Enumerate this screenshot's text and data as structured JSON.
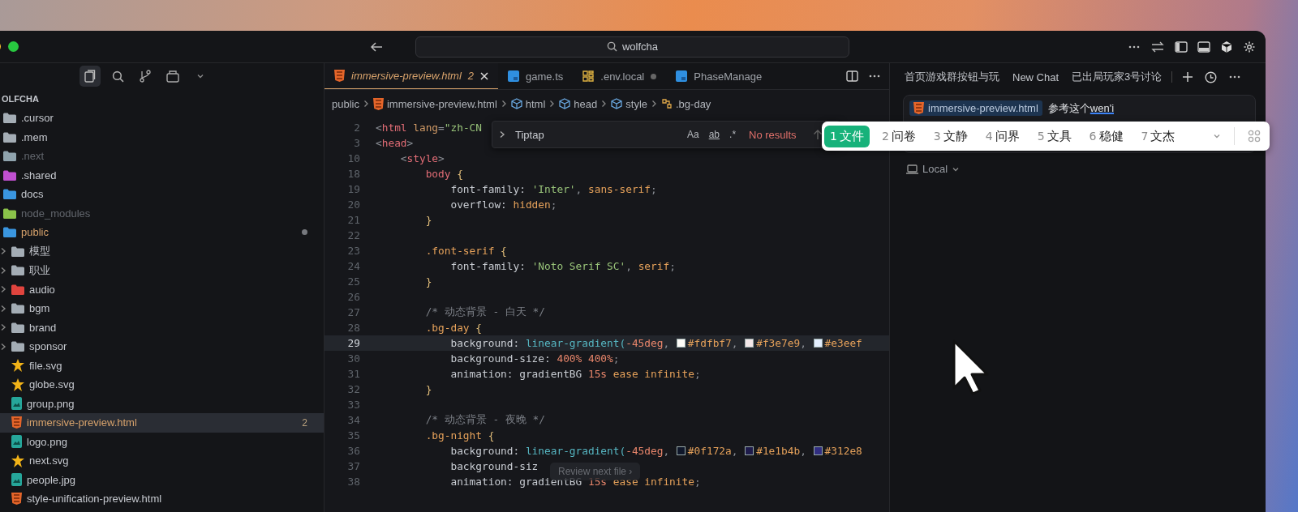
{
  "title_bar": {
    "search": "wolfcha"
  },
  "sidebar": {
    "root": "OLFCHA",
    "items": [
      {
        "name": ".cursor",
        "kind": "folder",
        "color": "#a4adb5",
        "selected": false,
        "dimmed": false,
        "modified": false
      },
      {
        "name": ".mem",
        "kind": "folder",
        "color": "#a4adb5",
        "selected": false,
        "dimmed": false,
        "modified": false
      },
      {
        "name": ".next",
        "kind": "folder",
        "color": "#8fa3ad",
        "selected": false,
        "dimmed": true,
        "modified": false
      },
      {
        "name": ".shared",
        "kind": "folder",
        "color": "#c050d0",
        "selected": false,
        "dimmed": false,
        "modified": false
      },
      {
        "name": "docs",
        "kind": "folder",
        "color": "#3a96e0",
        "selected": false,
        "dimmed": false,
        "modified": false
      },
      {
        "name": "node_modules",
        "kind": "folder",
        "color": "#8bc34a",
        "selected": false,
        "dimmed": true,
        "modified": false
      },
      {
        "name": "public",
        "kind": "folder",
        "color": "#3a96e0",
        "selected": false,
        "dimmed": false,
        "modified": true,
        "dot": true,
        "children": [
          {
            "name": "模型",
            "kind": "folder",
            "color": "#a4adb5",
            "expanded": false,
            "selected": false,
            "dimmed": false,
            "modified": false
          },
          {
            "name": "职业",
            "kind": "folder",
            "color": "#a4adb5",
            "expanded": false,
            "selected": false,
            "dimmed": false,
            "modified": false
          },
          {
            "name": "audio",
            "kind": "folder",
            "color": "#e0443e",
            "expanded": false,
            "selected": false,
            "dimmed": false,
            "modified": false
          },
          {
            "name": "bgm",
            "kind": "folder",
            "color": "#a4adb5",
            "expanded": false,
            "selected": false,
            "dimmed": false,
            "modified": false
          },
          {
            "name": "brand",
            "kind": "folder",
            "color": "#a4adb5",
            "expanded": false,
            "selected": false,
            "dimmed": false,
            "modified": false
          },
          {
            "name": "sponsor",
            "kind": "folder",
            "color": "#a4adb5",
            "expanded": false,
            "selected": false,
            "dimmed": false,
            "modified": false
          },
          {
            "name": "file.svg",
            "kind": "svg",
            "selected": false,
            "dimmed": false,
            "modified": false
          },
          {
            "name": "globe.svg",
            "kind": "svg",
            "selected": false,
            "dimmed": false,
            "modified": false
          },
          {
            "name": "group.png",
            "kind": "image",
            "selected": false,
            "dimmed": false,
            "modified": false
          },
          {
            "name": "immersive-preview.html",
            "kind": "html",
            "selected": true,
            "dimmed": false,
            "modified": true,
            "badge": "2"
          },
          {
            "name": "logo.png",
            "kind": "image",
            "selected": false,
            "dimmed": false,
            "modified": false
          },
          {
            "name": "next.svg",
            "kind": "svg",
            "selected": false,
            "dimmed": false,
            "modified": false
          },
          {
            "name": "people.jpg",
            "kind": "image",
            "selected": false,
            "dimmed": false,
            "modified": false
          },
          {
            "name": "style-unification-preview.html",
            "kind": "html",
            "selected": false,
            "dimmed": false,
            "modified": false
          }
        ]
      }
    ]
  },
  "editor": {
    "tabs": [
      {
        "label": "immersive-preview.html",
        "kind": "html",
        "badge": "2",
        "selected": true,
        "dot": false
      },
      {
        "label": "game.ts",
        "kind": "ts",
        "selected": false,
        "dot": false
      },
      {
        "label": ".env.local",
        "kind": "env",
        "selected": false,
        "dot": true
      },
      {
        "label": "PhaseManage",
        "kind": "ts",
        "selected": false,
        "dot": false
      }
    ],
    "breadcrumb": [
      {
        "label": "public",
        "kind": "folder"
      },
      {
        "label": "immersive-preview.html",
        "kind": "html"
      },
      {
        "label": "html",
        "kind": "element"
      },
      {
        "label": "head",
        "kind": "element"
      },
      {
        "label": "style",
        "kind": "element"
      },
      {
        "label": ".bg-day",
        "kind": "selector"
      }
    ],
    "find": {
      "value": "Tiptap",
      "options": [
        "Aa",
        "ab",
        ".*"
      ],
      "result": "No results"
    },
    "lines": [
      {
        "number": "2",
        "current": false,
        "tokens": [
          {
            "kind": "punct",
            "text": "<"
          },
          {
            "kind": "tag",
            "text": "html"
          },
          {
            "kind": "attr",
            "text": " lang"
          },
          {
            "kind": "punct",
            "text": "="
          },
          {
            "kind": "str",
            "text": "\"zh-CN"
          }
        ]
      },
      {
        "number": "3",
        "current": false,
        "tokens": [
          {
            "kind": "punct",
            "text": "<"
          },
          {
            "kind": "tag",
            "text": "head"
          },
          {
            "kind": "punct",
            "text": ">"
          }
        ]
      },
      {
        "number": "10",
        "current": false,
        "tokens": [
          {
            "kind": "punct",
            "text": "    <"
          },
          {
            "kind": "tag",
            "text": "style"
          },
          {
            "kind": "punct",
            "text": ">"
          }
        ]
      },
      {
        "number": "18",
        "current": false,
        "tokens": [
          {
            "kind": "tag",
            "text": "        body"
          },
          {
            "kind": "brace",
            "text": " {"
          }
        ]
      },
      {
        "number": "19",
        "current": false,
        "tokens": [
          {
            "kind": "prop",
            "text": "            font-family: "
          },
          {
            "kind": "str",
            "text": "'Inter'"
          },
          {
            "kind": "punct",
            "text": ", "
          },
          {
            "kind": "val",
            "text": "sans-serif"
          },
          {
            "kind": "punct",
            "text": ";"
          }
        ]
      },
      {
        "number": "20",
        "current": false,
        "tokens": [
          {
            "kind": "prop",
            "text": "            overflow: "
          },
          {
            "kind": "val",
            "text": "hidden"
          },
          {
            "kind": "punct",
            "text": ";"
          }
        ]
      },
      {
        "number": "21",
        "current": false,
        "tokens": [
          {
            "kind": "brace",
            "text": "        }"
          }
        ]
      },
      {
        "number": "22",
        "current": false
      },
      {
        "number": "23",
        "current": false,
        "tokens": [
          {
            "kind": "sel",
            "text": "        .font-serif"
          },
          {
            "kind": "brace",
            "text": " {"
          }
        ]
      },
      {
        "number": "24",
        "current": false,
        "tokens": [
          {
            "kind": "prop",
            "text": "            font-family: "
          },
          {
            "kind": "str",
            "text": "'Noto Serif SC'"
          },
          {
            "kind": "punct",
            "text": ", "
          },
          {
            "kind": "val",
            "text": "serif"
          },
          {
            "kind": "punct",
            "text": ";"
          }
        ]
      },
      {
        "number": "25",
        "current": false,
        "tokens": [
          {
            "kind": "brace",
            "text": "        }"
          }
        ]
      },
      {
        "number": "26",
        "current": false
      },
      {
        "number": "27",
        "current": false,
        "tokens": [
          {
            "kind": "comment",
            "text": "        /* 动态背景 - 白天 */"
          }
        ]
      },
      {
        "number": "28",
        "current": false,
        "tokens": [
          {
            "kind": "sel",
            "text": "        .bg-day"
          },
          {
            "kind": "brace",
            "text": " {"
          }
        ]
      },
      {
        "number": "29",
        "current": true,
        "tokens": [
          {
            "kind": "prop",
            "text": "            background: "
          },
          {
            "kind": "fn",
            "text": "linear-gradient("
          },
          {
            "kind": "num",
            "text": "-45deg"
          },
          {
            "kind": "punct",
            "text": ", "
          },
          {
            "kind": "color",
            "text": "#fdfbf7",
            "color": "#fdfbf7"
          },
          {
            "kind": "punct",
            "text": ", "
          },
          {
            "kind": "color",
            "text": "#f3e7e9",
            "color": "#f3e7e9"
          },
          {
            "kind": "punct",
            "text": ", "
          },
          {
            "kind": "color",
            "text": "#e3eef",
            "color": "#e3eeff"
          }
        ]
      },
      {
        "number": "30",
        "current": false,
        "tokens": [
          {
            "kind": "prop",
            "text": "            background-size: "
          },
          {
            "kind": "num",
            "text": "400% 400%"
          },
          {
            "kind": "punct",
            "text": ";"
          }
        ]
      },
      {
        "number": "31",
        "current": false,
        "tokens": [
          {
            "kind": "prop",
            "text": "            animation: gradientBG "
          },
          {
            "kind": "num",
            "text": "15s"
          },
          {
            "kind": "val",
            "text": " ease infinite"
          },
          {
            "kind": "punct",
            "text": ";"
          }
        ]
      },
      {
        "number": "32",
        "current": false,
        "tokens": [
          {
            "kind": "brace",
            "text": "        }"
          }
        ]
      },
      {
        "number": "33",
        "current": false
      },
      {
        "number": "34",
        "current": false,
        "tokens": [
          {
            "kind": "comment",
            "text": "        /* 动态背景 - 夜晚 */"
          }
        ]
      },
      {
        "number": "35",
        "current": false,
        "tokens": [
          {
            "kind": "sel",
            "text": "        .bg-night"
          },
          {
            "kind": "brace",
            "text": " {"
          }
        ]
      },
      {
        "number": "36",
        "current": false,
        "tokens": [
          {
            "kind": "prop",
            "text": "            background: "
          },
          {
            "kind": "fn",
            "text": "linear-gradient("
          },
          {
            "kind": "num",
            "text": "-45deg"
          },
          {
            "kind": "punct",
            "text": ", "
          },
          {
            "kind": "color",
            "text": "#0f172a",
            "color": "#0f172a"
          },
          {
            "kind": "punct",
            "text": ", "
          },
          {
            "kind": "color",
            "text": "#1e1b4b",
            "color": "#1e1b4b"
          },
          {
            "kind": "punct",
            "text": ", "
          },
          {
            "kind": "color",
            "text": "#312e8",
            "color": "#312e81"
          }
        ]
      },
      {
        "number": "37",
        "current": false,
        "tokens": [
          {
            "kind": "prop",
            "text": "            background-siz"
          }
        ]
      },
      {
        "number": "38",
        "current": false,
        "tokens": [
          {
            "kind": "prop",
            "text": "            animation: gradientBG "
          },
          {
            "kind": "num",
            "text": "15s"
          },
          {
            "kind": "val",
            "text": " ease infinite"
          },
          {
            "kind": "punct",
            "text": ";"
          }
        ]
      }
    ],
    "review_hint": "Review next file ›"
  },
  "chat": {
    "tabs": [
      {
        "label": "首页游戏群按钮与玩",
        "selected": false
      },
      {
        "label": "New Chat",
        "selected": false
      },
      {
        "label": "已出局玩家3号讨论",
        "selected": false
      }
    ],
    "input": {
      "chip": "immersive-preview.html",
      "text": "参考这个",
      "composing": "wen'i"
    },
    "mode": "Local"
  },
  "ime": {
    "candidates": [
      {
        "index": "1",
        "text": "文件",
        "selected": true
      },
      {
        "index": "2",
        "text": "问卷",
        "selected": false
      },
      {
        "index": "3",
        "text": "文静",
        "selected": false
      },
      {
        "index": "4",
        "text": "问界",
        "selected": false
      },
      {
        "index": "5",
        "text": "文具",
        "selected": false
      },
      {
        "index": "6",
        "text": "稳健",
        "selected": false
      },
      {
        "index": "7",
        "text": "文杰",
        "selected": false
      }
    ]
  }
}
